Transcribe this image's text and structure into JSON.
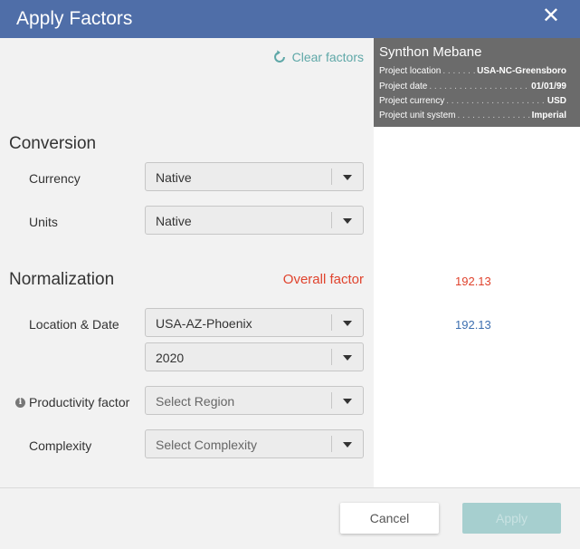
{
  "dialog": {
    "title": "Apply Factors",
    "close_glyph": "✕"
  },
  "clear_factors": "Clear factors",
  "project": {
    "name": "Synthon Mebane",
    "rows": [
      {
        "key": "Project location",
        "dots": ". . . . . . . . . . . . . . . . . . .",
        "value": "USA-NC-Greensboro"
      },
      {
        "key": "Project date",
        "dots": ". . . . . . . . . . . . . . . . . . . . . . . . . . . .",
        "value": "01/01/99"
      },
      {
        "key": "Project currency",
        "dots": ". . . . . . . . . . . . . . . . . . . . . . . .",
        "value": "USD"
      },
      {
        "key": "Project unit system",
        "dots": ". . . . . . . . . . . . . . . . . . . .",
        "value": "Imperial"
      }
    ]
  },
  "conversion": {
    "title": "Conversion",
    "currency": {
      "label": "Currency",
      "value": "Native"
    },
    "units": {
      "label": "Units",
      "value": "Native"
    }
  },
  "normalization": {
    "title": "Normalization",
    "overall_label": "Overall factor",
    "overall_value": "192.13",
    "location_date": {
      "label": "Location & Date",
      "location": "USA-AZ-Phoenix",
      "year": "2020",
      "value": "192.13"
    },
    "productivity": {
      "label": "Productivity factor",
      "placeholder": "Select Region"
    },
    "complexity": {
      "label": "Complexity",
      "placeholder": "Select Complexity"
    }
  },
  "footer": {
    "cancel": "Cancel",
    "apply": "Apply"
  },
  "colors": {
    "header": "#4f6ea8",
    "overall": "#e0432d",
    "factor": "#3d6fb0",
    "accent": "#5fa8a8"
  }
}
